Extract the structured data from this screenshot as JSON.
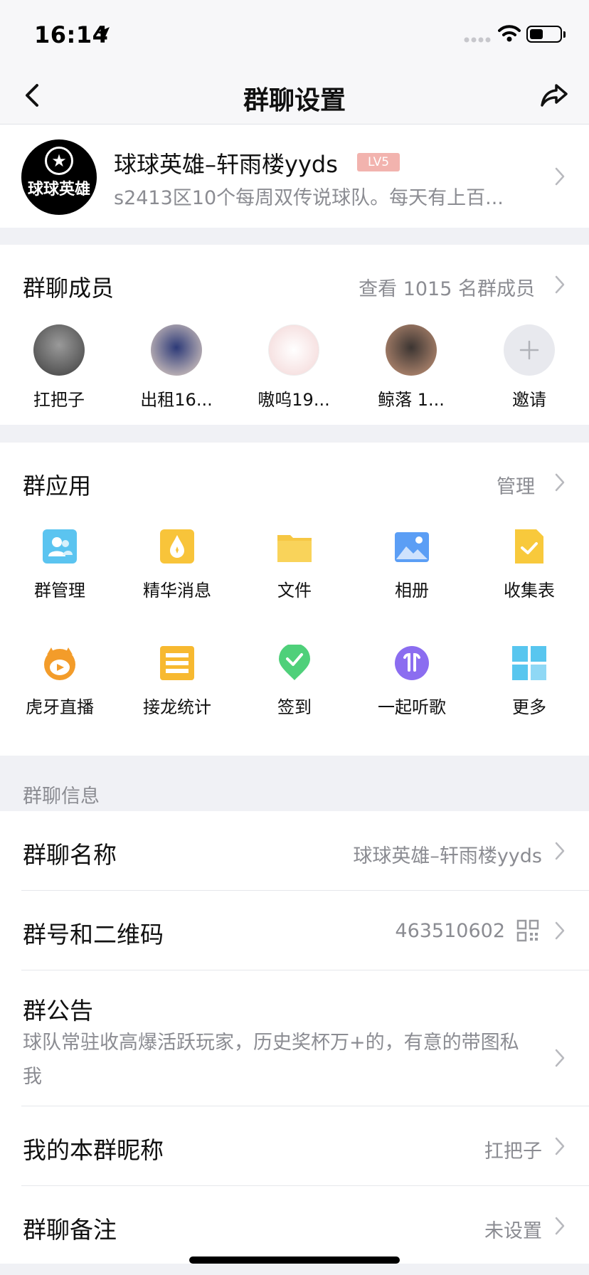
{
  "status": {
    "time": "16:14"
  },
  "nav": {
    "title": "群聊设置"
  },
  "group": {
    "avatar_text": "球球英雄",
    "name": "球球英雄–轩雨楼yyds",
    "level": "LV5",
    "description": "s2413区10个每周双传说球队。每天有上百..."
  },
  "members": {
    "title": "群聊成员",
    "view_all": "查看 1015 名群成员",
    "list": [
      {
        "name": "扛把子"
      },
      {
        "name": "出租16..."
      },
      {
        "name": "嗷呜19..."
      },
      {
        "name": "鲸落  1..."
      }
    ],
    "invite": "邀请"
  },
  "apps": {
    "title": "群应用",
    "manage": "管理",
    "items": [
      {
        "label": "群管理",
        "icon": "group-manage-icon",
        "color": "#5bc4f0"
      },
      {
        "label": "精华消息",
        "icon": "essence-icon",
        "color": "#f8c43a"
      },
      {
        "label": "文件",
        "icon": "folder-icon",
        "color": "#f6c743"
      },
      {
        "label": "相册",
        "icon": "album-icon",
        "color": "#5b9ef5"
      },
      {
        "label": "收集表",
        "icon": "form-icon",
        "color": "#f8c93c"
      },
      {
        "label": "虎牙直播",
        "icon": "huya-icon",
        "color": "#f39c2a"
      },
      {
        "label": "接龙统计",
        "icon": "list-icon",
        "color": "#f7b930"
      },
      {
        "label": "签到",
        "icon": "checkin-icon",
        "color": "#4fd07a"
      },
      {
        "label": "一起听歌",
        "icon": "music-icon",
        "color": "#8b6df0"
      },
      {
        "label": "更多",
        "icon": "more-grid-icon",
        "color": "#58c6ef"
      }
    ]
  },
  "info": {
    "section_label": "群聊信息",
    "rows": {
      "name_title": "群聊名称",
      "name_value": "球球英雄–轩雨楼yyds",
      "number_title": "群号和二维码",
      "number_value": "463510602",
      "notice_title": "群公告",
      "notice_value": "球队常驻收高爆活跃玩家，历史奖杯万+的，有意的带图私我",
      "nick_title": "我的本群昵称",
      "nick_value": "扛把子",
      "remark_title": "群聊备注",
      "remark_value": "未设置"
    }
  }
}
